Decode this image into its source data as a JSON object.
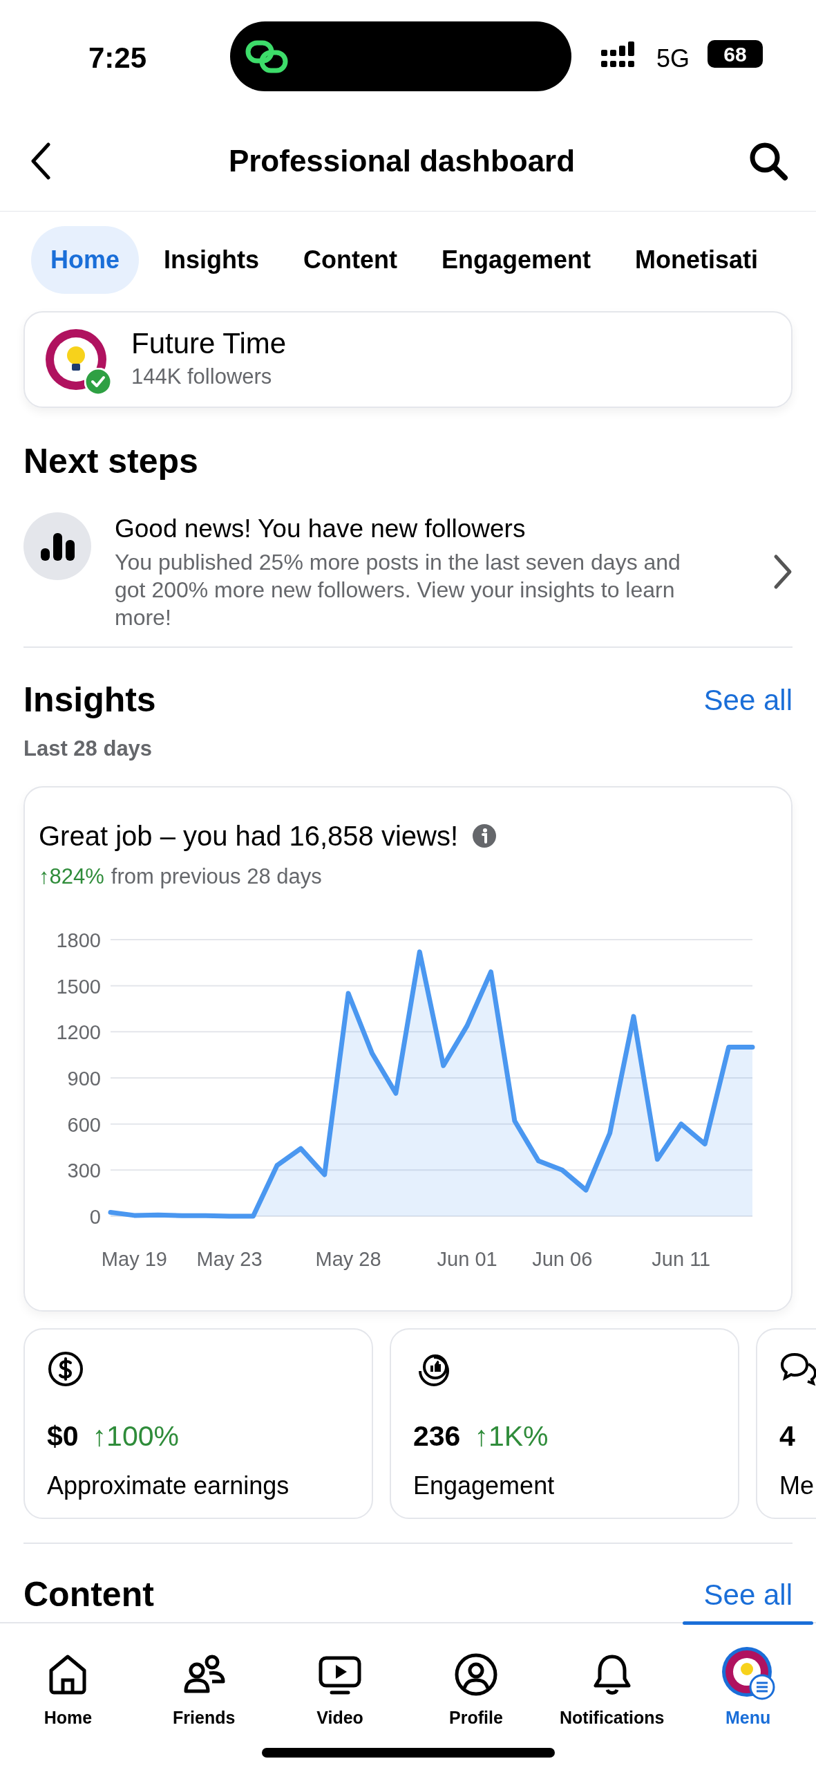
{
  "status_bar": {
    "time": "7:25",
    "network": "5G",
    "battery": "68"
  },
  "header": {
    "title": "Professional dashboard"
  },
  "tabs": [
    {
      "label": "Home",
      "selected": true
    },
    {
      "label": "Insights",
      "selected": false
    },
    {
      "label": "Content",
      "selected": false
    },
    {
      "label": "Engagement",
      "selected": false
    },
    {
      "label": "Monetisati",
      "selected": false
    }
  ],
  "profile": {
    "name": "Future Time",
    "followers": "144K followers",
    "verified": true
  },
  "next_steps": {
    "heading": "Next steps",
    "items": [
      {
        "title": "Good news! You have new followers",
        "body": "You published 25% more posts in the last seven days and got 200% more new followers. View your insights to learn more!"
      }
    ]
  },
  "insights": {
    "heading": "Insights",
    "link": "See all",
    "period": "Last 28 days",
    "views_card": {
      "headline": "Great job – you had 16,858 views!",
      "change": "↑824%",
      "change_note": "from previous 28 days",
      "chart_data": {
        "type": "area",
        "grid": true,
        "categories": [
          null,
          "May 19",
          null,
          null,
          null,
          "May 23",
          null,
          null,
          null,
          null,
          "May 28",
          null,
          null,
          null,
          null,
          "Jun 01",
          null,
          null,
          null,
          "Jun 06",
          null,
          null,
          null,
          null,
          "Jun 11",
          null,
          null,
          null
        ],
        "series": [
          {
            "color": "#4a97f0",
            "values": [
              25,
              5,
              8,
              3,
              3,
              0,
              0,
              330,
              440,
              270,
              1450,
              1060,
              800,
              1720,
              980,
              1240,
              1590,
              620,
              360,
              300,
              170,
              540,
              1300,
              370,
              600,
              470,
              1100,
              1100
            ]
          }
        ],
        "ylim": [
          0,
          1800
        ],
        "yticks": [
          0,
          300,
          600,
          900,
          1200,
          1500,
          1800
        ]
      }
    },
    "stats": [
      {
        "kind": "earnings",
        "value": "$0",
        "change": "↑100%",
        "label": "Approximate earnings"
      },
      {
        "kind": "engagement",
        "value": "236",
        "change": "↑1K%",
        "label": "Engagement"
      },
      {
        "kind": "messages",
        "value": "4",
        "label": "Me"
      }
    ]
  },
  "content": {
    "heading": "Content",
    "link": "See all"
  },
  "bottom_nav": [
    {
      "kind": "home",
      "label": "Home",
      "selected": false
    },
    {
      "kind": "friends",
      "label": "Friends",
      "selected": false
    },
    {
      "kind": "video",
      "label": "Video",
      "selected": false
    },
    {
      "kind": "profile",
      "label": "Profile",
      "selected": false
    },
    {
      "kind": "notifications",
      "label": "Notifications",
      "selected": false
    },
    {
      "kind": "menu",
      "label": "Menu",
      "selected": true
    }
  ]
}
